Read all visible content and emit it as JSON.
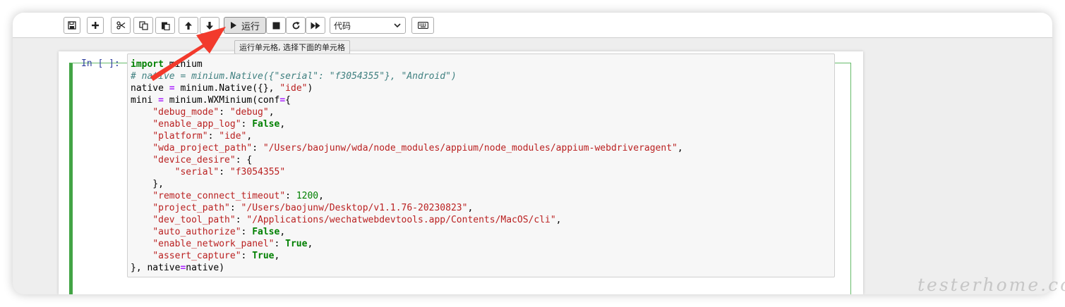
{
  "toolbar": {
    "icons": [
      "save-icon",
      "plus-icon",
      "cut-icon",
      "copy-icon",
      "paste-icon",
      "arrow-up-icon",
      "arrow-down-icon",
      "play-icon",
      "stop-icon",
      "restart-icon",
      "fast-forward-icon",
      "keyboard-icon"
    ],
    "run_label": "运行",
    "cell_type": "代码"
  },
  "tooltip": "运行单元格, 选择下面的单元格",
  "cell": {
    "prompt": "In [ ]:",
    "code_lines": [
      "import minium",
      "# native = minium.Native({\"serial\": \"f3054355\"}, \"Android\")",
      "native = minium.Native({}, \"ide\")",
      "mini = minium.WXMinium(conf={",
      "    \"debug_mode\": \"debug\",",
      "    \"enable_app_log\": False,",
      "    \"platform\": \"ide\",",
      "    \"wda_project_path\": \"/Users/baojunw/wda/node_modules/appium/node_modules/appium-webdriveragent\",",
      "    \"device_desire\": {",
      "        \"serial\": \"f3054355\"",
      "    },",
      "    \"remote_connect_timeout\": 1200,",
      "    \"project_path\": \"/Users/baojunw/Desktop/v1.1.76-20230823\",",
      "    \"dev_tool_path\": \"/Applications/wechatwebdevtools.app/Contents/MacOS/cli\",",
      "    \"auto_authorize\": False,",
      "    \"enable_network_panel\": True,",
      "    \"assert_capture\": True,",
      "}, native=native)"
    ]
  },
  "colors": {
    "keyword": "#008000",
    "comment": "#408080",
    "string": "#ba2121",
    "number": "#008000",
    "operator": "#aa22ff",
    "prompt": "#303f9f",
    "cell_border": "#42a445",
    "arrow": "#f23a2c"
  },
  "watermark": "testerhome.com"
}
